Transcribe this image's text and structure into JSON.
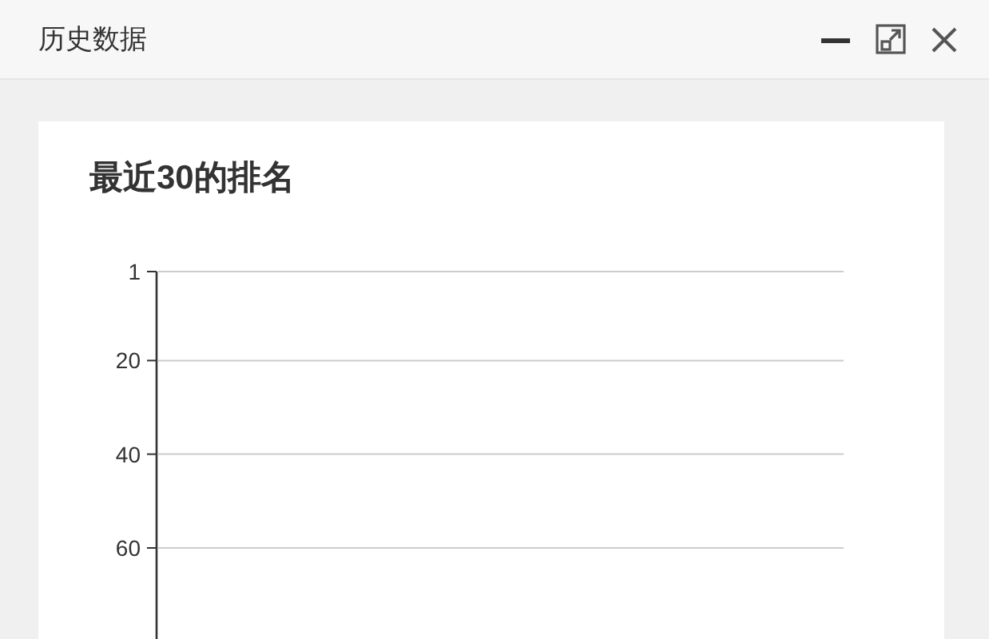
{
  "window": {
    "title": "历史数据"
  },
  "card": {
    "title": "最近30的排名",
    "y_axis": {
      "labels": [
        "1",
        "20",
        "40",
        "60"
      ]
    }
  }
}
